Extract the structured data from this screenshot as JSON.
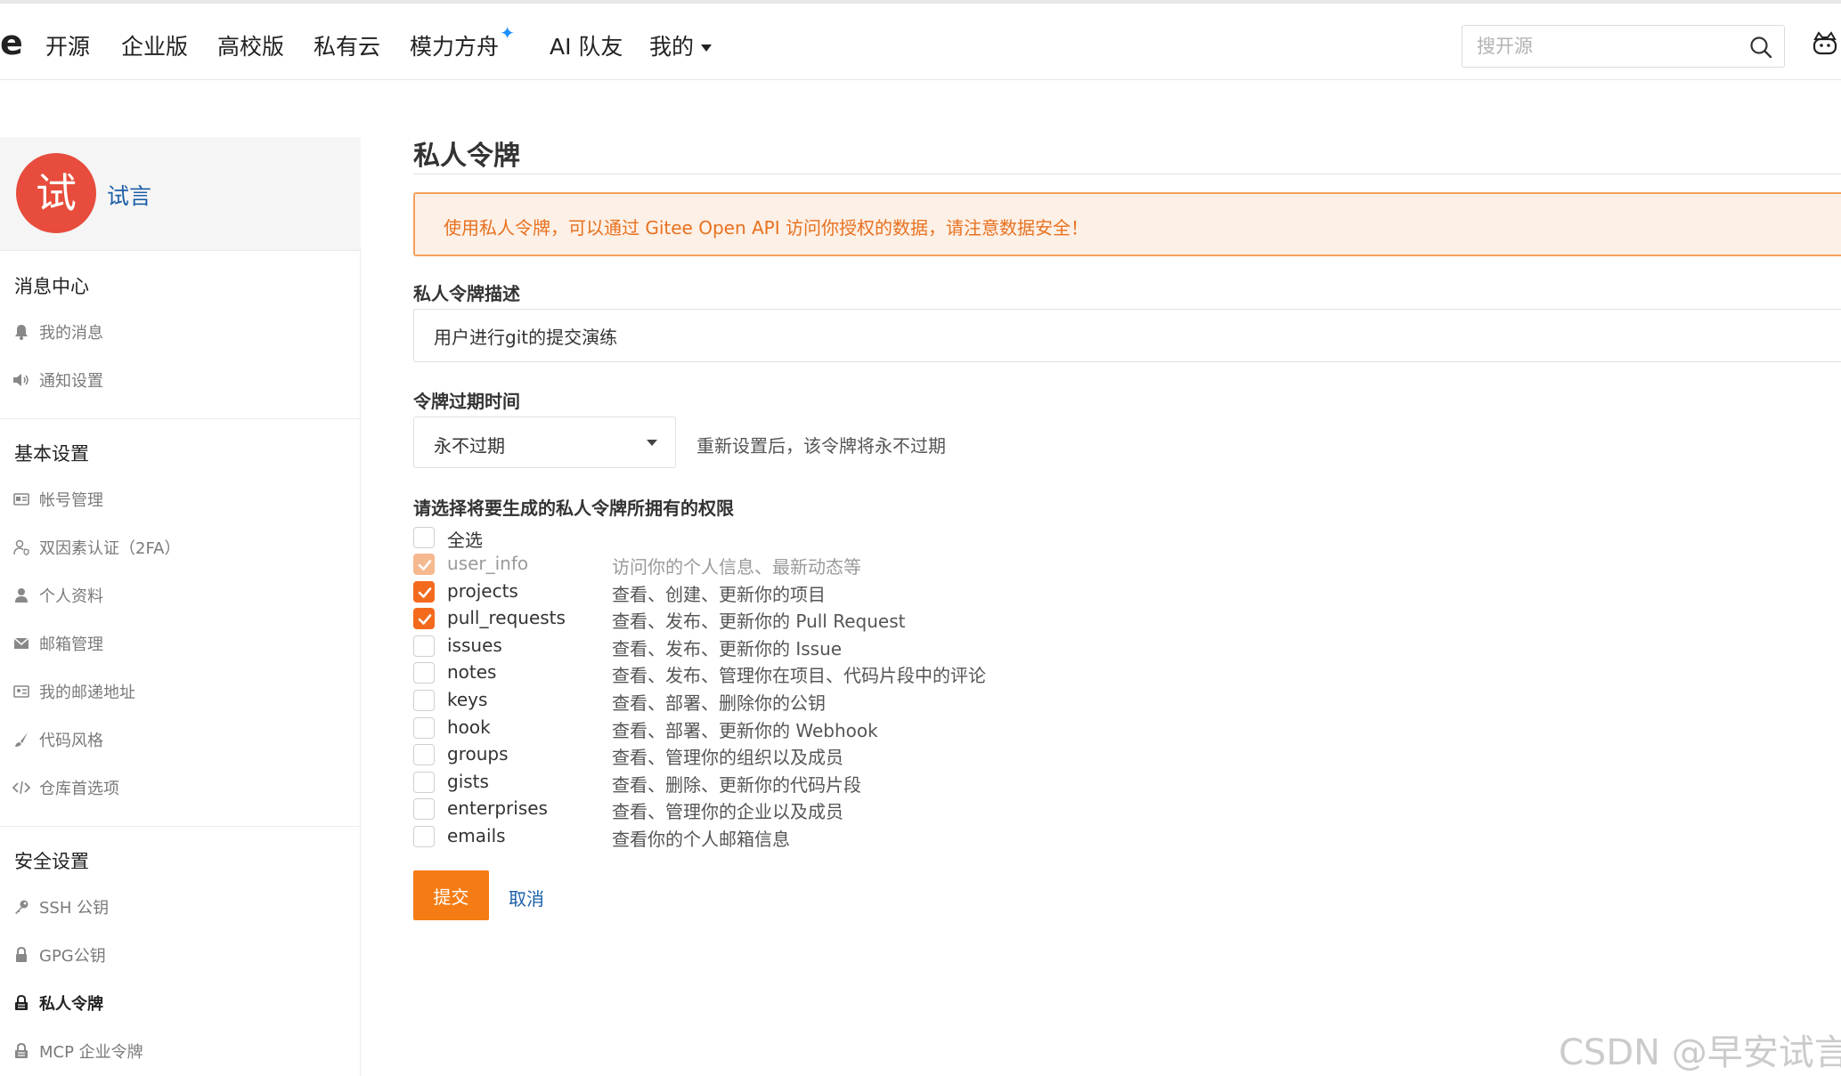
{
  "nav": {
    "logo_fragment": "e",
    "items": [
      "开源",
      "企业版",
      "高校版",
      "私有云",
      "模力方舟",
      "AI 队友",
      "我的"
    ],
    "search_placeholder": "搜开源"
  },
  "sidebar": {
    "avatar_char": "试",
    "username": "试言",
    "sections": [
      {
        "title": "消息中心",
        "items": [
          "我的消息",
          "通知设置"
        ]
      },
      {
        "title": "基本设置",
        "items": [
          "帐号管理",
          "双因素认证（2FA）",
          "个人资料",
          "邮箱管理",
          "我的邮递地址",
          "代码风格",
          "仓库首选项"
        ]
      },
      {
        "title": "安全设置",
        "items": [
          "SSH 公钥",
          "GPG公钥",
          "私人令牌",
          "MCP 企业令牌"
        ]
      }
    ],
    "active_item": "私人令牌"
  },
  "main": {
    "title": "私人令牌",
    "notice": "使用私人令牌，可以通过 Gitee Open API 访问你授权的数据，请注意数据安全！",
    "desc_label": "私人令牌描述",
    "desc_value": "用户进行git的提交演练",
    "expiry_label": "令牌过期时间",
    "expiry_value": "永不过期",
    "expiry_hint": "重新设置后，该令牌将永不过期",
    "perms_label": "请选择将要生成的私人令牌所拥有的权限",
    "select_all": "全选",
    "permissions": [
      {
        "name": "user_info",
        "desc": "访问你的个人信息、最新动态等",
        "checked": true,
        "disabled": true
      },
      {
        "name": "projects",
        "desc": "查看、创建、更新你的项目",
        "checked": true,
        "disabled": false
      },
      {
        "name": "pull_requests",
        "desc": "查看、发布、更新你的 Pull Request",
        "checked": true,
        "disabled": false
      },
      {
        "name": "issues",
        "desc": "查看、发布、更新你的 Issue",
        "checked": false,
        "disabled": false
      },
      {
        "name": "notes",
        "desc": "查看、发布、管理你在项目、代码片段中的评论",
        "checked": false,
        "disabled": false
      },
      {
        "name": "keys",
        "desc": "查看、部署、删除你的公钥",
        "checked": false,
        "disabled": false
      },
      {
        "name": "hook",
        "desc": "查看、部署、更新你的 Webhook",
        "checked": false,
        "disabled": false
      },
      {
        "name": "groups",
        "desc": "查看、管理你的组织以及成员",
        "checked": false,
        "disabled": false
      },
      {
        "name": "gists",
        "desc": "查看、删除、更新你的代码片段",
        "checked": false,
        "disabled": false
      },
      {
        "name": "enterprises",
        "desc": "查看、管理你的企业以及成员",
        "checked": false,
        "disabled": false
      },
      {
        "name": "emails",
        "desc": "查看你的个人邮箱信息",
        "checked": false,
        "disabled": false
      }
    ],
    "submit_label": "提交",
    "cancel_label": "取消"
  },
  "watermark": "CSDN @早安试言",
  "colors": {
    "accent": "#f57c14",
    "link": "#1b5fa8",
    "avatar_bg": "#e74c3c",
    "notice_text": "#e8711f"
  }
}
